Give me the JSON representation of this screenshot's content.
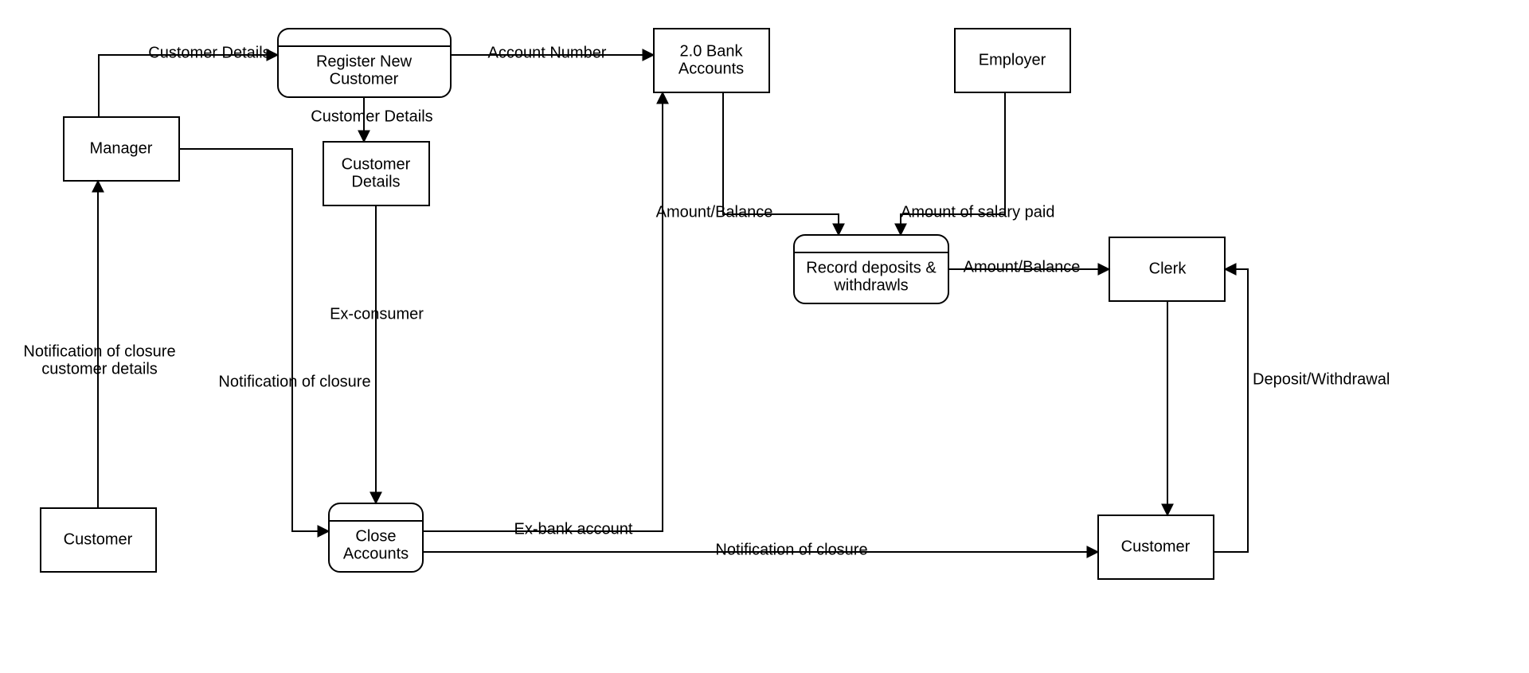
{
  "nodes": {
    "manager": "Manager",
    "customer_left": "Customer",
    "register_new_customer": {
      "line1": "Register New",
      "line2": "Customer"
    },
    "customer_details": {
      "line1": "Customer",
      "line2": "Details"
    },
    "close_accounts": {
      "line1": "Close",
      "line2": "Accounts"
    },
    "bank_accounts": {
      "line1": "2.0 Bank",
      "line2": "Accounts"
    },
    "employer": "Employer",
    "record_deposits": {
      "line1": "Record deposits &",
      "line2": "withdrawls"
    },
    "clerk": "Clerk",
    "customer_right": "Customer"
  },
  "edges": {
    "customer_details_1": "Customer Details",
    "account_number": "Account Number",
    "customer_details_2": "Customer Details",
    "notif_closure_details_1": "Notification of closure",
    "notif_closure_details_2": "customer details",
    "ex_consumer": "Ex-consumer",
    "notif_closure_1": "Notification of closure",
    "ex_bank_account": "Ex-bank account",
    "notif_closure_2": "Notification of closure",
    "amount_balance_1": "Amount/Balance",
    "amount_salary": "Amount of salary paid",
    "amount_balance_2": "Amount/Balance",
    "deposit_withdrawal": "Deposit/Withdrawal"
  }
}
